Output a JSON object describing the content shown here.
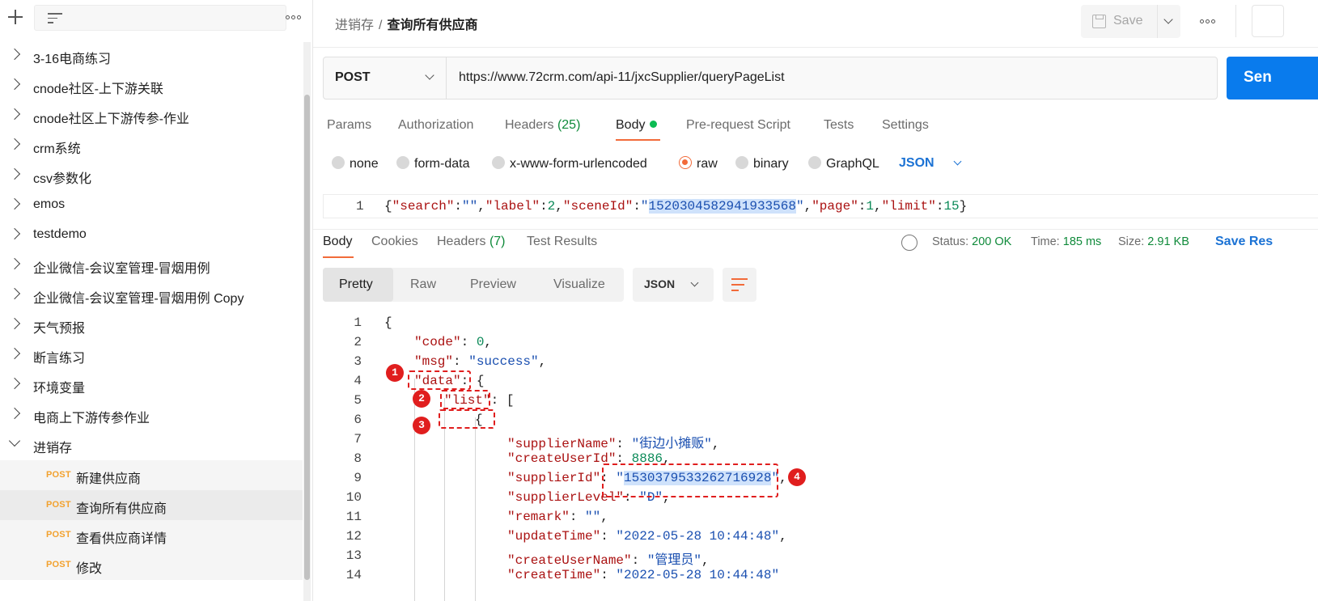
{
  "sidebar": {
    "collections": [
      "3-16电商练习",
      "cnode社区-上下游关联",
      "cnode社区上下游传参-作业",
      "crm系统",
      "csv参数化",
      "emos",
      "testdemo",
      "企业微信-会议室管理-冒烟用例",
      "企业微信-会议室管理-冒烟用例 Copy",
      "天气预报",
      "断言练习",
      "环境变量",
      "电商上下游传参作业",
      "进销存"
    ],
    "requests": [
      {
        "method": "POST",
        "label": "新建供应商"
      },
      {
        "method": "POST",
        "label": "查询所有供应商"
      },
      {
        "method": "POST",
        "label": "查看供应商详情"
      },
      {
        "method": "POST",
        "label": "修改"
      }
    ]
  },
  "header": {
    "breadcrumb_parent": "进销存",
    "breadcrumb_sep": "/",
    "breadcrumb_current": "查询所有供应商",
    "save_label": "Save"
  },
  "request": {
    "method": "POST",
    "url": "https://www.72crm.com/api-11/jxcSupplier/queryPageList",
    "send_label": "Sen",
    "tabs": {
      "params": "Params",
      "authorization": "Authorization",
      "headers": "Headers",
      "headers_count": "(25)",
      "body": "Body",
      "prerequest": "Pre-request Script",
      "tests": "Tests",
      "settings": "Settings"
    },
    "body_types": [
      "none",
      "form-data",
      "x-www-form-urlencoded",
      "raw",
      "binary",
      "GraphQL"
    ],
    "body_format": "JSON",
    "body_line_no": "1",
    "body_tokens": {
      "open": "{",
      "k_search": "\"search\"",
      "v_search": "\"\"",
      "k_label": "\"label\"",
      "v_label": "2",
      "k_scene": "\"sceneId\"",
      "v_scene_q1": "\"",
      "v_scene": "1520304582941933568",
      "v_scene_q2": "\"",
      "k_page": "\"page\"",
      "v_page": "1",
      "k_limit": "\"limit\"",
      "v_limit": "15",
      "close": "}"
    }
  },
  "response": {
    "tabs": {
      "body": "Body",
      "cookies": "Cookies",
      "headers": "Headers",
      "headers_count": "(7)",
      "test_results": "Test Results"
    },
    "status_label": "Status:",
    "status": "200 OK",
    "time_label": "Time:",
    "time": "185 ms",
    "size_label": "Size:",
    "size": "2.91 KB",
    "save_label": "Save Res",
    "views": [
      "Pretty",
      "Raw",
      "Preview",
      "Visualize"
    ],
    "format": "JSON",
    "line_numbers": [
      "1",
      "2",
      "3",
      "4",
      "5",
      "6",
      "7",
      "8",
      "9",
      "10",
      "11",
      "12",
      "13",
      "14"
    ],
    "code": {
      "l1": "{",
      "l2_k": "\"code\"",
      "l2_v": "0",
      "l3_k": "\"msg\"",
      "l3_v": "\"success\"",
      "l4_k": "\"data\"",
      "l4_p": ": {",
      "l5_k": "\"list\"",
      "l5_p": ": [",
      "l6": "{",
      "l7_k": "\"supplierName\"",
      "l7_v": "\"街边小摊贩\"",
      "l8_k": "\"createUserId\"",
      "l8_v": "8886",
      "l9_k": "\"supplierId\"",
      "l9_q": "\"",
      "l9_v": "1530379533262716928",
      "l9_q2": "\"",
      "l10_k": "\"supplierLevel\"",
      "l10_v": "\"D\"",
      "l11_k": "\"remark\"",
      "l11_v": "\"\"",
      "l12_k": "\"updateTime\"",
      "l12_v": "\"2022-05-28 10:44:48\"",
      "l13_k": "\"createUserName\"",
      "l13_v": "\"管理员\"",
      "l14_k": "\"createTime\"",
      "l14_v": "\"2022-05-28 10:44:48\""
    }
  },
  "annotations": [
    "1",
    "2",
    "3",
    "4"
  ],
  "colors": {
    "accent": "#f26b3a",
    "send": "#097bed",
    "annotation": "#e01e1e",
    "method_post": "#f2a12e"
  }
}
